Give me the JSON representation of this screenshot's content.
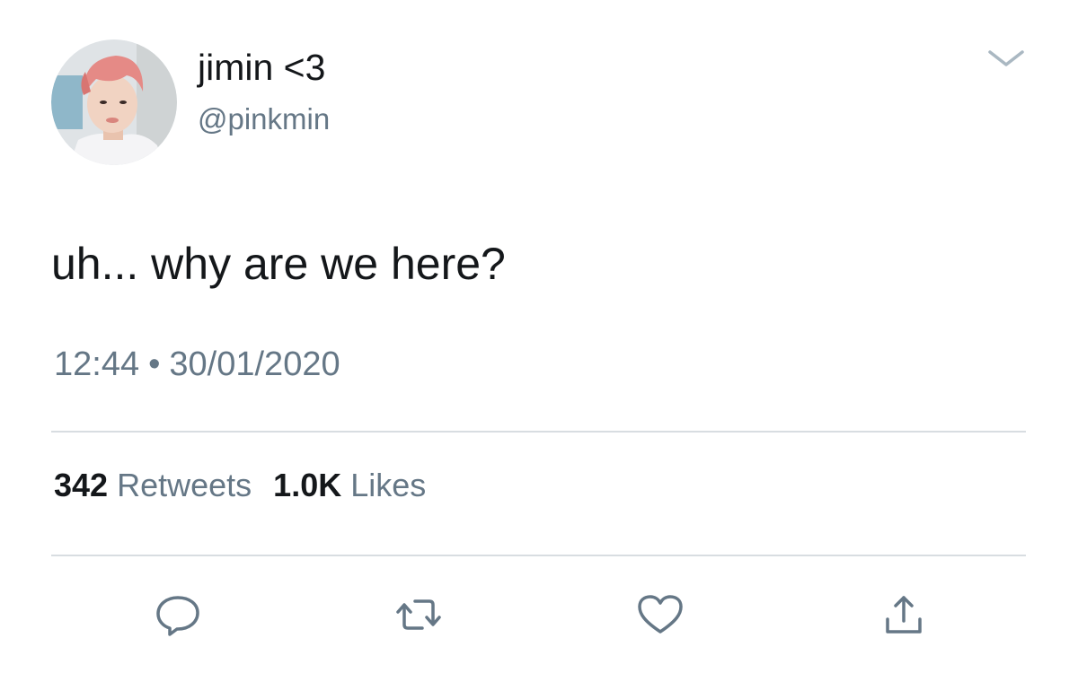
{
  "user": {
    "display_name": "jimin <3",
    "handle": "@pinkmin",
    "avatar_icon": "profile-photo"
  },
  "header": {
    "menu_icon": "chevron-down-icon"
  },
  "tweet": {
    "text": "uh... why are we here?",
    "time": "12:44",
    "separator": "•",
    "date": "30/01/2020"
  },
  "stats": {
    "retweets_count": "342",
    "retweets_label": "Retweets",
    "likes_count": "1.0K",
    "likes_label": "Likes"
  },
  "actions": {
    "reply_icon": "reply-icon",
    "retweet_icon": "retweet-icon",
    "like_icon": "heart-icon",
    "share_icon": "share-icon"
  },
  "colors": {
    "primary_text": "#14171a",
    "secondary_text": "#657786",
    "divider": "#d8dde1",
    "icon": "#657786"
  }
}
